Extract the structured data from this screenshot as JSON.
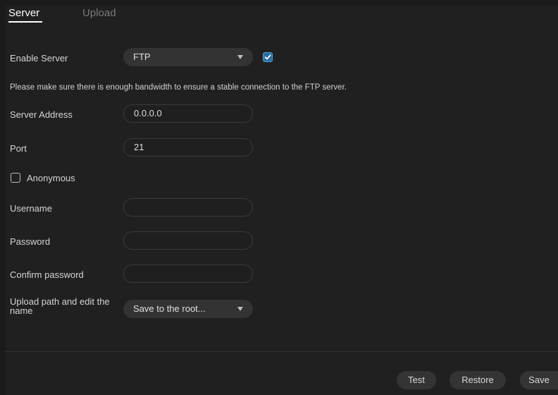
{
  "tabs": [
    {
      "label": "Server"
    },
    {
      "label": "Upload"
    }
  ],
  "enable_server": {
    "label": "Enable Server",
    "protocol": "FTP",
    "enabled": true
  },
  "notice": "Please make sure there is enough bandwidth to ensure a stable connection to the FTP server.",
  "server_address": {
    "label": "Server Address",
    "value": "0.0.0.0"
  },
  "port": {
    "label": "Port",
    "value": "21"
  },
  "anonymous": {
    "label": "Anonymous",
    "checked": false
  },
  "username": {
    "label": "Username",
    "value": ""
  },
  "password": {
    "label": "Password",
    "value": ""
  },
  "confirm_password": {
    "label": "Confirm password",
    "value": ""
  },
  "upload_path": {
    "label": "Upload path and edit the name",
    "value": "Save to the root..."
  },
  "buttons": {
    "test": "Test",
    "restore": "Restore",
    "save": "Save"
  },
  "colors": {
    "background": "#202020",
    "accent": "#2a6ea0",
    "button": "#343434"
  }
}
